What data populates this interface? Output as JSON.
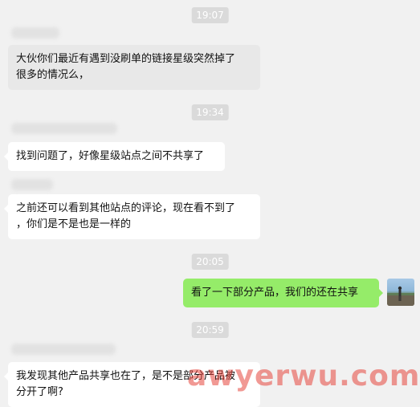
{
  "chat": {
    "timestamps": [
      "19:07",
      "19:34",
      "20:05",
      "20:59"
    ],
    "messages": [
      {
        "line1": "大伙你们最近有遇到没刷单的链接星级突然掉了",
        "line2": "很多的情况么，"
      },
      {
        "line1": "找到问题了，好像星级站点之间不共享了"
      },
      {
        "line1": "之前还可以看到其他站点的评论，现在看不到了",
        "line2": "，你们是不是也是一样的"
      },
      {
        "line1": "看了一下部分产品，我们的还在共享"
      },
      {
        "line1": "我发现其他产品共享也在了，是不是部分产品被",
        "line2": "分开了啊?"
      }
    ]
  },
  "watermark": "awyerwu.com",
  "colors": {
    "background": "#f1f1f1",
    "self_bubble": "#95ec69",
    "other_bubble": "#ffffff"
  }
}
